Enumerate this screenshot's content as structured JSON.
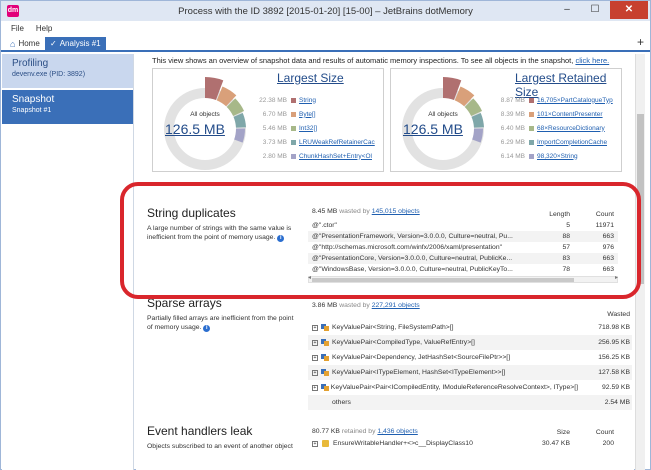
{
  "window": {
    "title": "Process with the ID 3892 [2015-01-20] [15-00] – JetBrains dotMemory",
    "minimize": "–",
    "maximize": "☐",
    "close": "✕"
  },
  "menu": {
    "file": "File",
    "help": "Help"
  },
  "tabs": {
    "home": "Home",
    "analysis": "Analysis #1",
    "add": "+"
  },
  "sidebar": {
    "profiling_title": "Profiling",
    "profiling_sub": "devenv.exe (PID: 3892)",
    "snapshot_title": "Snapshot",
    "snapshot_sub": "Snapshot #1"
  },
  "overview": {
    "note": "This view shows an overview of snapshot data and results of automatic memory inspections. To see all objects in the snapshot,",
    "link": "click here."
  },
  "largest_size": {
    "title": "Largest Size",
    "all_objects_label": "All objects",
    "total": "126.5 MB",
    "rows": [
      {
        "size": "22.38 MB",
        "name": "String",
        "color": "#b07070"
      },
      {
        "size": "6.70 MB",
        "name": "Byte[]",
        "color": "#d9a07a"
      },
      {
        "size": "5.46 MB",
        "name": "Int32[]",
        "color": "#a7b889"
      },
      {
        "size": "3.73 MB",
        "name": "LRUWeakRefRetainerCac",
        "color": "#7fa7a9"
      },
      {
        "size": "2.80 MB",
        "name": "ChunkHashSet+Entry<Ol",
        "color": "#a3a3c7"
      }
    ]
  },
  "largest_retained": {
    "title": "Largest Retained Size",
    "all_objects_label": "All objects",
    "total": "126.5 MB",
    "rows": [
      {
        "size": "8.87 MB",
        "name": "16,705×PartCatalogueTyp",
        "color": "#b07070"
      },
      {
        "size": "8.39 MB",
        "name": "101×ContentPresenter",
        "color": "#d9a07a"
      },
      {
        "size": "6.40 MB",
        "name": "68×ResourceDictionary",
        "color": "#a7b889"
      },
      {
        "size": "6.29 MB",
        "name": "ImportCompletionCache",
        "color": "#7fa7a9"
      },
      {
        "size": "6.14 MB",
        "name": "98,320×String",
        "color": "#a3a3c7"
      }
    ]
  },
  "string_duplicates": {
    "title": "String duplicates",
    "description": "A large number of strings with the same value is inefficient from the point of memory usage.",
    "wasted_amount": "8.45 MB",
    "wasted_by_text": "wasted by",
    "wasted_link": "145,015 objects",
    "col_length": "Length",
    "col_count": "Count",
    "rows": [
      {
        "value": "@\".ctor\"",
        "length": "5",
        "count": "11971"
      },
      {
        "value": "@\"PresentationFramework, Version=3.0.0.0, Culture=neutral, Pu...",
        "length": "88",
        "count": "663"
      },
      {
        "value": "@\"http://schemas.microsoft.com/winfx/2006/xaml/presentation\"",
        "length": "57",
        "count": "976"
      },
      {
        "value": "@\"PresentationCore, Version=3.0.0.0, Culture=neutral, PublicKe...",
        "length": "83",
        "count": "663"
      },
      {
        "value": "@\"WindowsBase, Version=3.0.0.0, Culture=neutral, PublicKeyTo...",
        "length": "78",
        "count": "663"
      }
    ]
  },
  "sparse_arrays": {
    "title": "Sparse arrays",
    "description": "Partially filled arrays are inefficient from the point of memory usage.",
    "wasted_amount": "3.86 MB",
    "wasted_by_text": "wasted by",
    "wasted_link": "227,291 objects",
    "col_wasted": "Wasted",
    "rows": [
      {
        "name": "KeyValuePair<String, FileSystemPath>[]",
        "wasted": "718.98 KB"
      },
      {
        "name": "KeyValuePair<CompiledType, ValueRefEntry>[]",
        "wasted": "256.95 KB"
      },
      {
        "name": "KeyValuePair<Dependency, JetHashSet<SourceFilePtr>>[]",
        "wasted": "156.25 KB"
      },
      {
        "name": "KeyValuePair<ITypeElement, HashSet<ITypeElement>>[]",
        "wasted": "127.58 KB"
      },
      {
        "name": "KeyValuePair<Pair<ICompiledEntity, IModuleReferenceResolveContext>, IType>[]",
        "wasted": "92.59 KB"
      },
      {
        "name": "others",
        "wasted": "2.54 MB"
      }
    ]
  },
  "event_handlers": {
    "title": "Event handlers leak",
    "description": "Objects subscribed to an event of another object",
    "retained_amount": "80.77 KB",
    "retained_by_text": "retained by",
    "retained_link": "1,436 objects",
    "col_size": "Size",
    "col_count": "Count",
    "rows": [
      {
        "name": "EnsureWritableHandler+<>c__DisplayClass10",
        "size": "30.47 KB",
        "count": "200"
      }
    ]
  }
}
